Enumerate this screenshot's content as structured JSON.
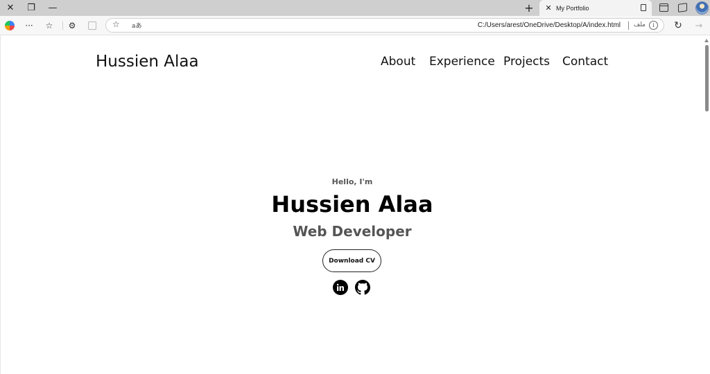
{
  "browser": {
    "tab_title": "My Portfolio",
    "address_url": "C:/Users/arest/OneDrive/Desktop/A/index.html",
    "address_file_label": "ملف",
    "read_aloud_label": "aあ"
  },
  "site": {
    "logo": "Hussien Alaa",
    "nav": [
      "About",
      "Experience",
      "Projects",
      "Contact"
    ]
  },
  "hero": {
    "greeting": "Hello, I'm",
    "name": "Hussien Alaa",
    "role": "Web Developer",
    "cv_button": "Download CV"
  },
  "icons": {
    "linkedin": "linkedin-icon",
    "github": "github-icon"
  }
}
